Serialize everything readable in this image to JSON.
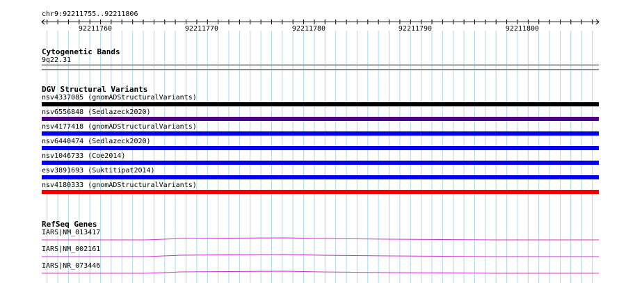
{
  "coordinate_label": "chr9:92211755..92211806",
  "ruler": {
    "ticks": [
      "92211760",
      "92211770",
      "92211780",
      "92211790",
      "92211800"
    ]
  },
  "tracks": {
    "cytoband": {
      "title": "Cytogenetic Bands",
      "band": "9q22.31"
    },
    "dgv": {
      "title": "DGV Structural Variants",
      "features": [
        {
          "label": "nsv4337085 (gnomADStructuralVariants)",
          "color": "#000000"
        },
        {
          "label": "nsv6556848 (Sedlazeck2020)",
          "color": "#4b0082"
        },
        {
          "label": "nsv4177418 (gnomADStructuralVariants)",
          "color": "#0000ee"
        },
        {
          "label": "nsv6440474 (Sedlazeck2020)",
          "color": "#0000ee"
        },
        {
          "label": "nsv1046733 (Coe2014)",
          "color": "#0000ee"
        },
        {
          "label": "esv3891693 (Suktitipat2014)",
          "color": "#0000ee"
        },
        {
          "label": "nsv4180333 (gnomADStructuralVariants)",
          "color": "#ee0000"
        }
      ]
    },
    "refseq": {
      "title": "RefSeq Genes",
      "genes": [
        {
          "label": "IARS|NM_013417",
          "color": "#cc33cc"
        },
        {
          "label": "IARS|NM_002161",
          "color": "#cc33cc"
        },
        {
          "label": "IARS|NR_073446",
          "color": "#cc33cc"
        }
      ]
    }
  },
  "colors": {
    "grid_minor": "#add8e6",
    "grid_major": "#7fb8cc"
  }
}
